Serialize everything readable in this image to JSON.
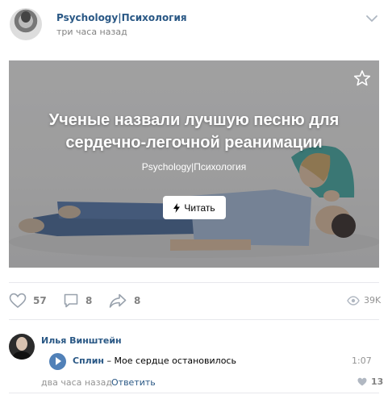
{
  "post": {
    "author": "Psychology|Психология",
    "time": "три часа назад",
    "menu_icon": "chevron-down-icon"
  },
  "card": {
    "title_line1": "Ученые назвали лучшую песню для",
    "title_line2": "сердечно-легочной реанимации",
    "source": "Psychology|Психология",
    "read_label": "Читать",
    "fave_icon": "star-icon"
  },
  "actions": {
    "likes": "57",
    "comments": "8",
    "shares": "8",
    "views": "39K"
  },
  "comment": {
    "author": "Илья Винштейн",
    "audio": {
      "artist": "Сплин",
      "separator": "–",
      "title": "Мое сердце остановилось",
      "duration": "1:07"
    },
    "time": "два часа назад",
    "reply_label": "Ответить",
    "likes": "13"
  },
  "colors": {
    "link": "#2a5885",
    "meta": "#828282",
    "play": "#5181b8",
    "divider": "#e7e8ec"
  }
}
